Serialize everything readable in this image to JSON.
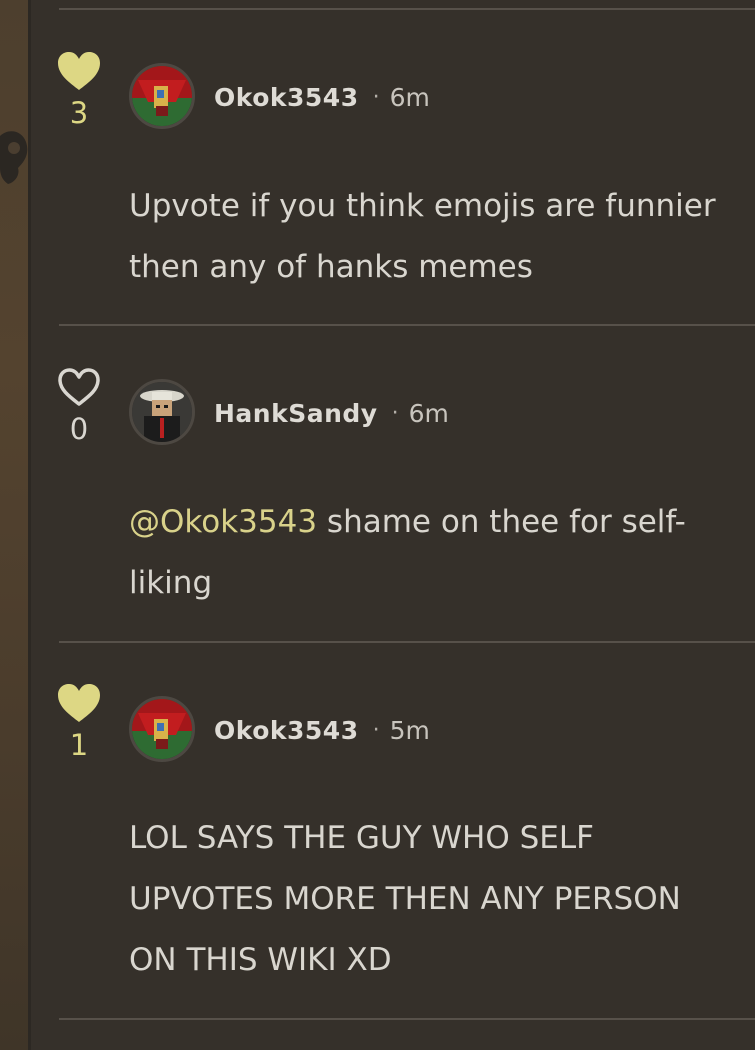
{
  "colors": {
    "background": "#35302a",
    "accent_like": "#ddd784",
    "mention": "#d9d28a",
    "text": "#d9d6cf",
    "divider": "#57514a"
  },
  "comments": [
    {
      "username": "Okok3543",
      "separator": "·",
      "time": "6m",
      "likes": "3",
      "liked": true,
      "avatar_icon": "user-avatar-red",
      "lines": [
        "Upvote if you think emojis are funnier",
        "then any of hanks memes"
      ]
    },
    {
      "username": "HankSandy",
      "separator": "·",
      "time": "6m",
      "likes": "0",
      "liked": false,
      "avatar_icon": "user-avatar-dark",
      "mention": "@Okok3543",
      "line1_rest": " shame on thee for self-",
      "line2": "liking"
    },
    {
      "username": "Okok3543",
      "separator": "·",
      "time": "5m",
      "likes": "1",
      "liked": true,
      "avatar_icon": "user-avatar-red",
      "lines": [
        "LOL SAYS THE GUY WHO SELF",
        "UPVOTES MORE THEN ANY PERSON",
        "ON THIS WIKI XD"
      ]
    }
  ]
}
